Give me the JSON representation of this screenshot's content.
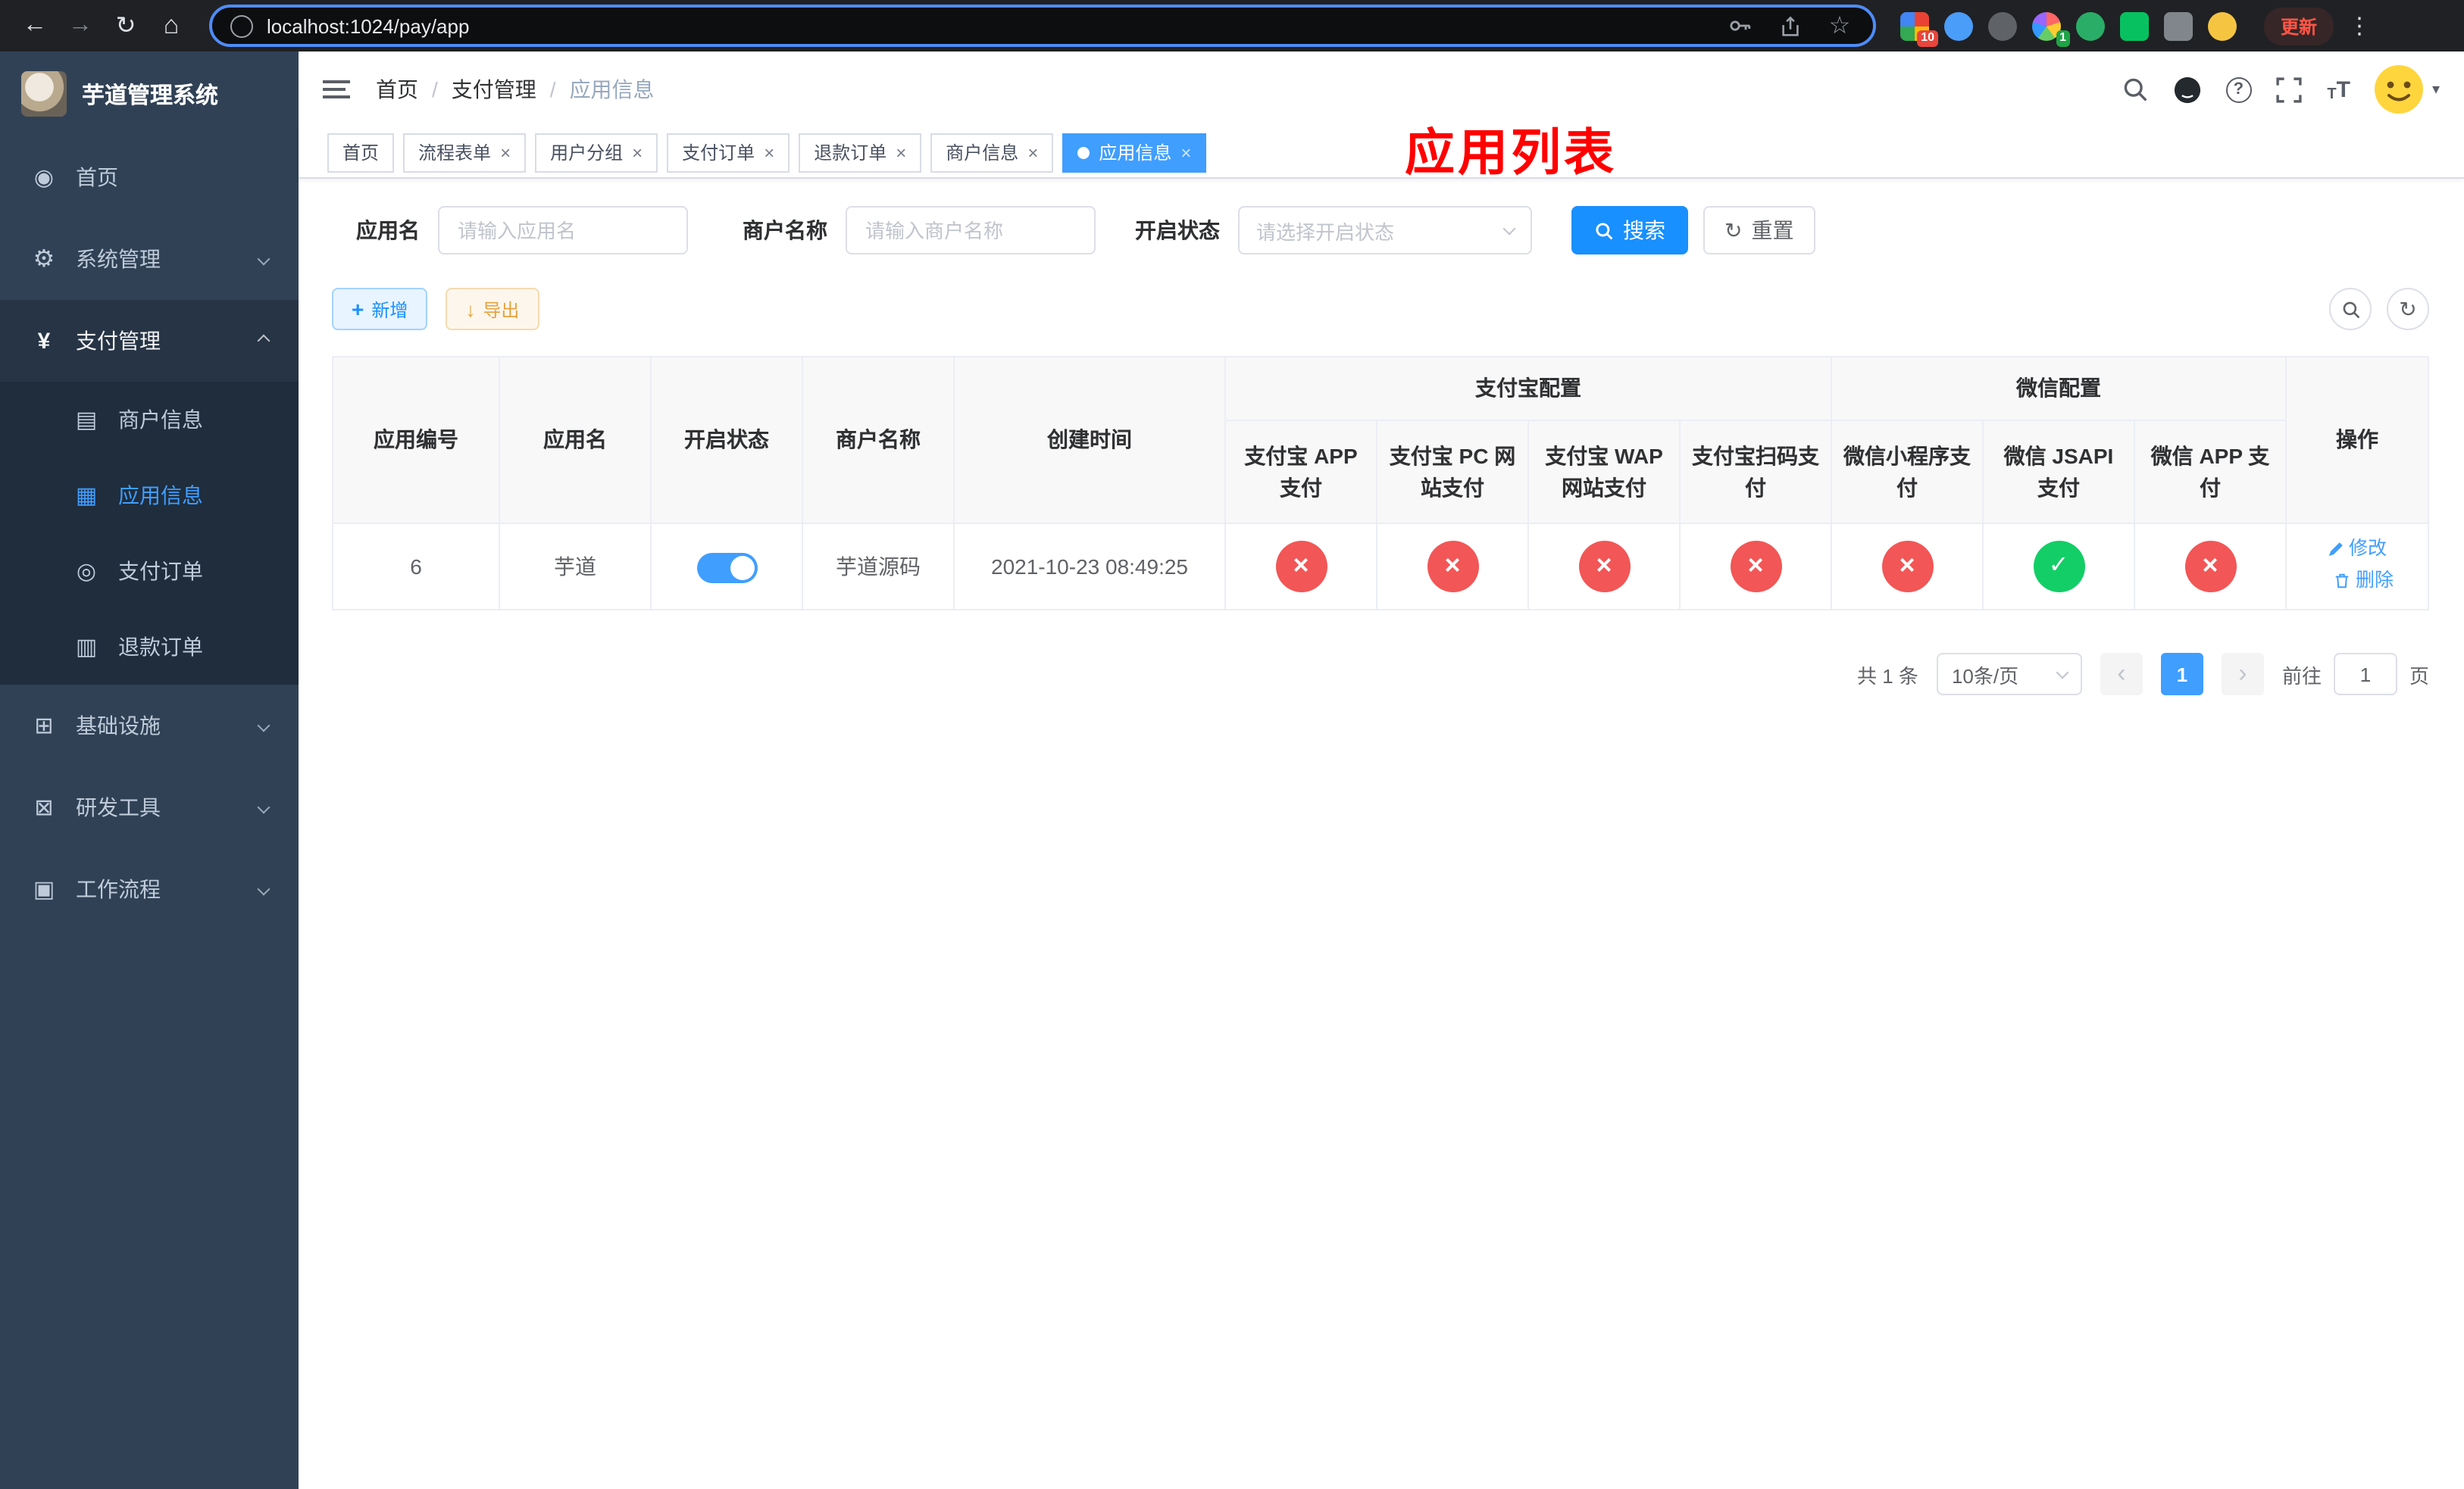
{
  "colors": {
    "accent": "#409eff",
    "primary_button": "#1890ff",
    "danger_status": "#f25656",
    "success_status": "#13ce66",
    "page_title_red": "#ff0000",
    "warning": "#e6a23c",
    "sidebar_bg": "#304156",
    "submenu_bg": "#1f2d3d"
  },
  "browser": {
    "url": "localhost:1024/pay/app",
    "update_label": "更新",
    "extension_badges": {
      "grid": "10",
      "colorful": "1"
    }
  },
  "sidebar": {
    "title": "芋道管理系统",
    "items": [
      {
        "label": "首页"
      },
      {
        "label": "系统管理"
      },
      {
        "label": "支付管理"
      },
      {
        "label": "基础设施"
      },
      {
        "label": "研发工具"
      },
      {
        "label": "工作流程"
      }
    ],
    "pay_submenu": [
      {
        "label": "商户信息"
      },
      {
        "label": "应用信息"
      },
      {
        "label": "支付订单"
      },
      {
        "label": "退款订单"
      }
    ]
  },
  "navbar": {
    "breadcrumb": [
      {
        "label": "首页"
      },
      {
        "label": "支付管理"
      },
      {
        "label": "应用信息"
      }
    ],
    "page_title": "应用列表"
  },
  "tabs": [
    {
      "label": "首页"
    },
    {
      "label": "流程表单"
    },
    {
      "label": "用户分组"
    },
    {
      "label": "支付订单"
    },
    {
      "label": "退款订单"
    },
    {
      "label": "商户信息"
    },
    {
      "label": "应用信息"
    }
  ],
  "filters": {
    "app_name_label": "应用名",
    "app_name_placeholder": "请输入应用名",
    "merchant_label": "商户名称",
    "merchant_placeholder": "请输入商户名称",
    "status_label": "开启状态",
    "status_placeholder": "请选择开启状态",
    "search_label": "搜索",
    "reset_label": "重置"
  },
  "toolbar": {
    "add_label": "新增",
    "export_label": "导出"
  },
  "table": {
    "groups": {
      "alipay": "支付宝配置",
      "wechat": "微信配置"
    },
    "columns": {
      "id": "应用编号",
      "name": "应用名",
      "status": "开启状态",
      "merchant": "商户名称",
      "created": "创建时间",
      "alipay_app": "支付宝 APP 支付",
      "alipay_pc": "支付宝 PC 网站支付",
      "alipay_wap": "支付宝 WAP 网站支付",
      "alipay_qr": "支付宝扫码支付",
      "wx_lite": "微信小程序支付",
      "wx_jsapi": "微信 JSAPI 支付",
      "wx_app": "微信 APP 支付",
      "actions": "操作"
    },
    "row": {
      "id": "6",
      "name": "芋道",
      "status_on": "true",
      "merchant": "芋道源码",
      "created": "2021-10-23 08:49:25",
      "alipay_app": "false",
      "alipay_pc": "false",
      "alipay_wap": "false",
      "alipay_qr": "false",
      "wx_lite": "false",
      "wx_jsapi": "true",
      "wx_app": "false",
      "edit_label": "修改",
      "delete_label": "删除"
    }
  },
  "pagination": {
    "total_text": "共 1 条",
    "page_size_text": "10条/页",
    "current_page": "1",
    "goto_label": "前往",
    "goto_value": "1",
    "unit_label": "页"
  },
  "icons": {
    "close_tab": "×",
    "fail_mark": "×",
    "success_mark": "✓"
  }
}
